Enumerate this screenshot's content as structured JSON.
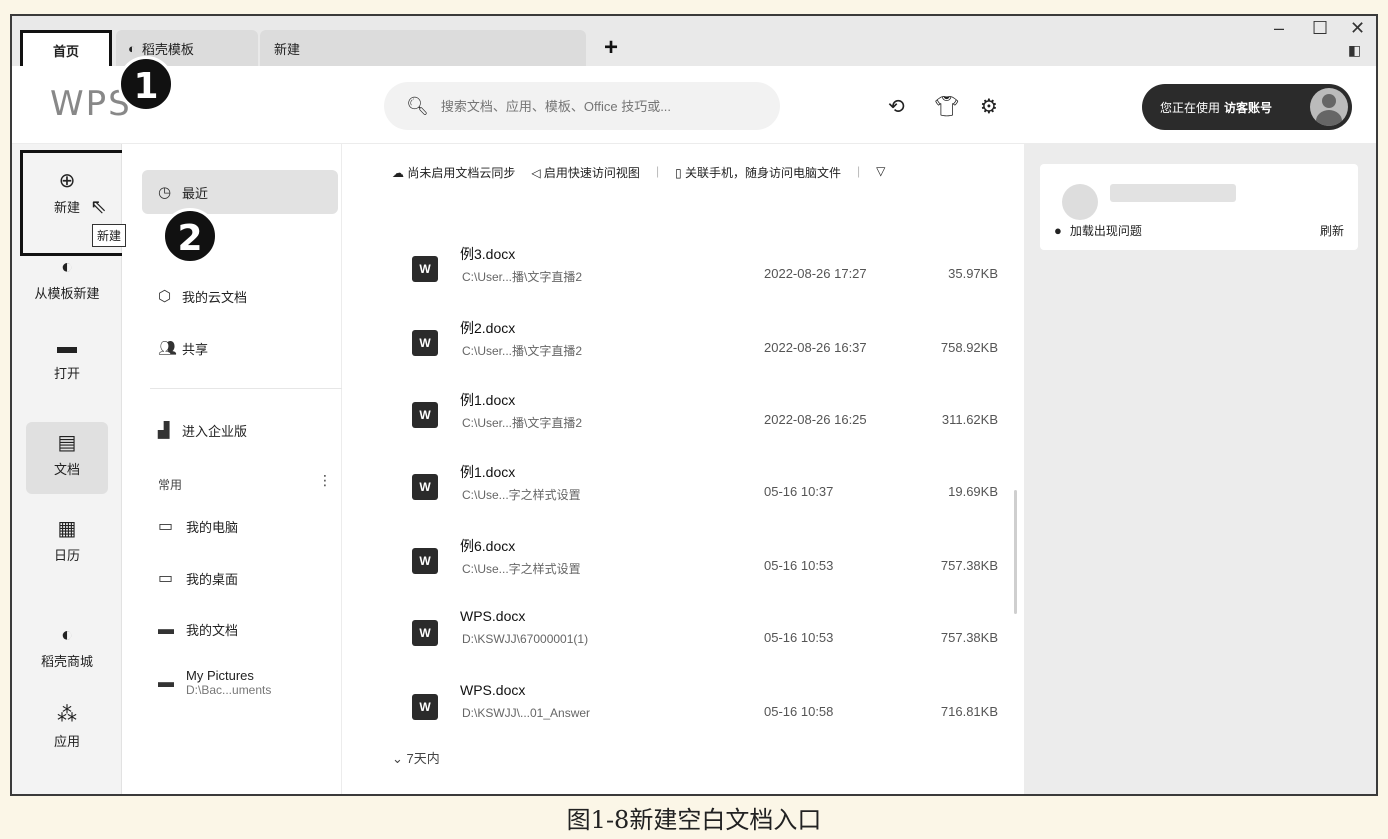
{
  "tabs": [
    {
      "label": "首页"
    },
    {
      "label": "稻壳模板"
    },
    {
      "label": "新建"
    }
  ],
  "tab_add_label": "+",
  "window_controls": {
    "minimize": "–",
    "maximize": "☐",
    "close": "✕"
  },
  "header": {
    "logo_text": "WPS",
    "search_placeholder": "搜索文档、应用、模板、Office 技巧或...",
    "account_prefix": "您正在使用",
    "account_name": "访客账号"
  },
  "rail": [
    {
      "label": "新建",
      "icon": "plus-circle-icon"
    },
    {
      "label": "从模板新建",
      "icon": "docer-icon"
    },
    {
      "label": "打开",
      "icon": "folder-icon"
    },
    {
      "label": "文档",
      "icon": "document-icon"
    },
    {
      "label": "日历",
      "icon": "calendar-icon"
    },
    {
      "label": "稻壳商城",
      "icon": "docer-store-icon"
    },
    {
      "label": "应用",
      "icon": "apps-icon"
    }
  ],
  "tooltip": "新建",
  "nav": {
    "recent": "最近",
    "cloud": "我的云文档",
    "share": "共享",
    "enterprise": "进入企业版",
    "common": "常用",
    "favorites": [
      {
        "label": "我的电脑",
        "sub": ""
      },
      {
        "label": "我的桌面",
        "sub": ""
      },
      {
        "label": "我的文档",
        "sub": ""
      },
      {
        "label": "My Pictures",
        "sub": "D:\\Bac...uments"
      }
    ]
  },
  "toolbar": [
    "尚未启用文档云同步",
    "启用快速访问视图",
    "关联手机，随身访问电脑文件"
  ],
  "files": [
    {
      "name": "例3.docx",
      "path": "C:\\User...播\\文字直播2",
      "date": "2022-08-26 17:27",
      "size": "35.97KB"
    },
    {
      "name": "例2.docx",
      "path": "C:\\User...播\\文字直播2",
      "date": "2022-08-26 16:37",
      "size": "758.92KB"
    },
    {
      "name": "例1.docx",
      "path": "C:\\User...播\\文字直播2",
      "date": "2022-08-26 16:25",
      "size": "311.62KB"
    },
    {
      "name": "例1.docx",
      "path": "C:\\Use...字之样式设置",
      "date": "05-16 10:37",
      "size": "19.69KB"
    },
    {
      "name": "例6.docx",
      "path": "C:\\Use...字之样式设置",
      "date": "05-16 10:53",
      "size": "757.38KB"
    },
    {
      "name": "WPS.docx",
      "path": "D:\\KSWJJ\\67000001(1)",
      "date": "05-16 10:53",
      "size": "757.38KB"
    },
    {
      "name": "WPS.docx",
      "path": "D:\\KSWJJ\\...01_Answer",
      "date": "05-16 10:58",
      "size": "716.81KB"
    }
  ],
  "section_7days": "7天内",
  "right_panel": {
    "message": "加载出现问题",
    "refresh": "刷新"
  },
  "callouts": [
    "1",
    "2"
  ],
  "caption": "图1-8新建空白文档入口"
}
